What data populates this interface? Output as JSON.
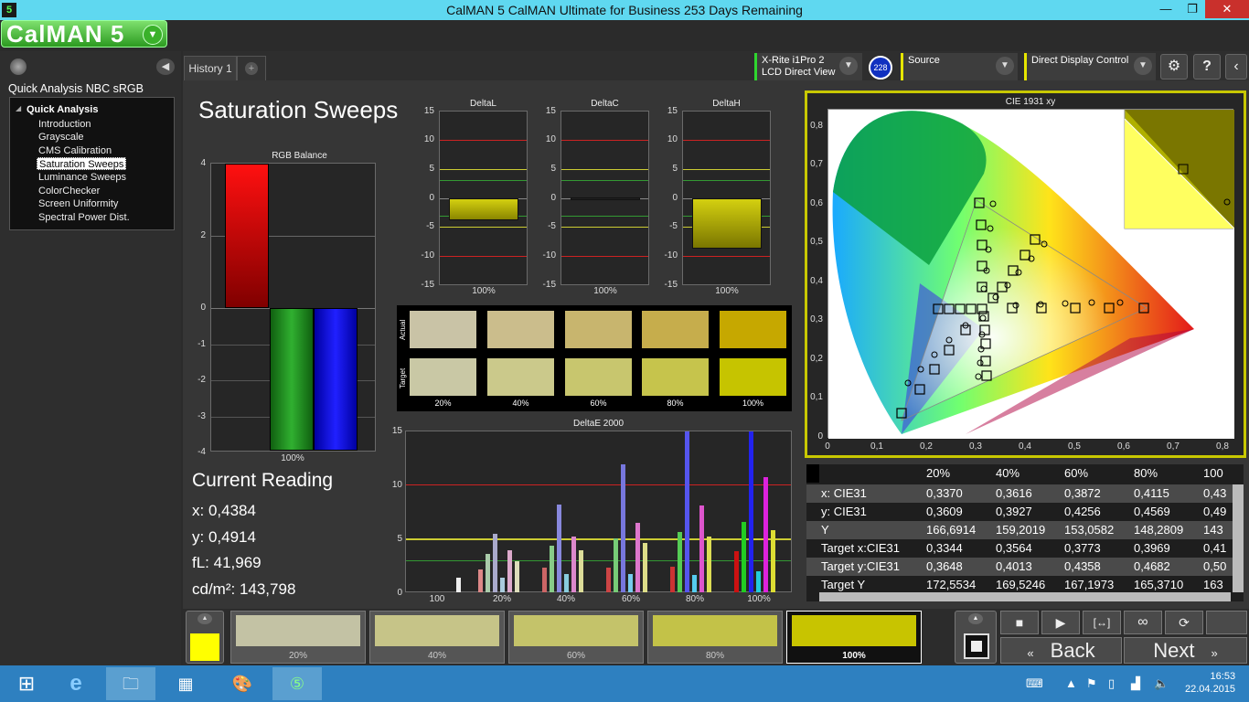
{
  "window": {
    "title": "CalMAN 5 CalMAN Ultimate for Business 253 Days Remaining",
    "app_icon": "5",
    "minimize": "—",
    "restore": "❐",
    "close": "✕"
  },
  "logo": {
    "text": "CalMAN 5"
  },
  "sidebar": {
    "title": "Quick Analysis NBC sRGB",
    "root": "Quick Analysis",
    "items": [
      {
        "label": "Introduction"
      },
      {
        "label": "Grayscale"
      },
      {
        "label": "CMS Calibration"
      },
      {
        "label": "Saturation Sweeps",
        "selected": true
      },
      {
        "label": "Luminance Sweeps"
      },
      {
        "label": "ColorChecker"
      },
      {
        "label": "Screen Uniformity"
      },
      {
        "label": "Spectral Power Dist."
      }
    ]
  },
  "tabs": {
    "history": "History 1",
    "add": "+"
  },
  "devices": {
    "meter_line1": "X-Rite i1Pro 2",
    "meter_line2": "LCD Direct View",
    "badge": "228",
    "source": "Source",
    "display": "Direct Display Control"
  },
  "toolbar": {
    "settings_icon": "gear-icon",
    "help": "?",
    "collapse": "‹"
  },
  "page": {
    "title": "Saturation Sweeps"
  },
  "rgb_balance": {
    "title": "RGB Balance",
    "y_ticks": [
      "4",
      "2",
      "0",
      "-1",
      "-2",
      "-3",
      "-4"
    ],
    "x_label": "100%"
  },
  "delta_charts": {
    "y_ticks": [
      "15",
      "10",
      "5",
      "0",
      "-5",
      "-10",
      "-15"
    ],
    "deltaL": {
      "title": "DeltaL",
      "x": "100%"
    },
    "deltaC": {
      "title": "DeltaC",
      "x": "100%"
    },
    "deltaH": {
      "title": "DeltaH",
      "x": "100%"
    }
  },
  "swatches": {
    "actual_label": "Actual",
    "target_label": "Target",
    "labels": [
      "20%",
      "40%",
      "60%",
      "80%",
      "100%"
    ],
    "actual_colors": [
      "#c9c3a6",
      "#cbbd8c",
      "#c8b56e",
      "#c6ad4c",
      "#c6a800"
    ],
    "target_colors": [
      "#c9c8a5",
      "#cbc98b",
      "#c8c66e",
      "#c6c44c",
      "#c6c400"
    ]
  },
  "deltaE": {
    "title": "DeltaE 2000",
    "y_ticks": [
      "15",
      "10",
      "5",
      "0"
    ],
    "x_ticks": [
      "100",
      "20%",
      "40%",
      "60%",
      "80%",
      "100%"
    ]
  },
  "current_reading": {
    "title": "Current Reading",
    "x": "x: 0,4384",
    "y": "y: 0,4914",
    "fL": "fL: 41,969",
    "cdm2": "cd/m²: 143,798"
  },
  "cie": {
    "title": "CIE 1931 xy",
    "y_ticks": [
      "0,8",
      "0,7",
      "0,6",
      "0,5",
      "0,4",
      "0,3",
      "0,2",
      "0,1",
      "0"
    ],
    "x_ticks": [
      "0",
      "0,1",
      "0,2",
      "0,3",
      "0,4",
      "0,5",
      "0,6",
      "0,7",
      "0,8"
    ]
  },
  "table": {
    "headers": [
      "20%",
      "40%",
      "60%",
      "80%",
      "100"
    ],
    "rows": [
      {
        "label": "x: CIE31",
        "values": [
          "0,3370",
          "0,3616",
          "0,3872",
          "0,4115",
          "0,43"
        ]
      },
      {
        "label": "y: CIE31",
        "values": [
          "0,3609",
          "0,3927",
          "0,4256",
          "0,4569",
          "0,49"
        ]
      },
      {
        "label": "Y",
        "values": [
          "166,6914",
          "159,2019",
          "153,0582",
          "148,2809",
          "143"
        ]
      },
      {
        "label": "Target x:CIE31",
        "values": [
          "0,3344",
          "0,3564",
          "0,3773",
          "0,3969",
          "0,41"
        ]
      },
      {
        "label": "Target y:CIE31",
        "values": [
          "0,3648",
          "0,4013",
          "0,4358",
          "0,4682",
          "0,50"
        ]
      },
      {
        "label": "Target Y",
        "values": [
          "172,5534",
          "169,5246",
          "167,1973",
          "165,3710",
          "163"
        ]
      }
    ]
  },
  "patches": {
    "labels": [
      "20%",
      "40%",
      "60%",
      "80%",
      "100%"
    ],
    "colors": [
      "#c3c2a4",
      "#c6c488",
      "#c4c36a",
      "#c3c248",
      "#c8c400"
    ],
    "current": "#ffff00"
  },
  "controls": {
    "back": "Back",
    "next": "Next"
  },
  "taskbar": {
    "time": "16:53",
    "date": "22.04.2015"
  }
}
